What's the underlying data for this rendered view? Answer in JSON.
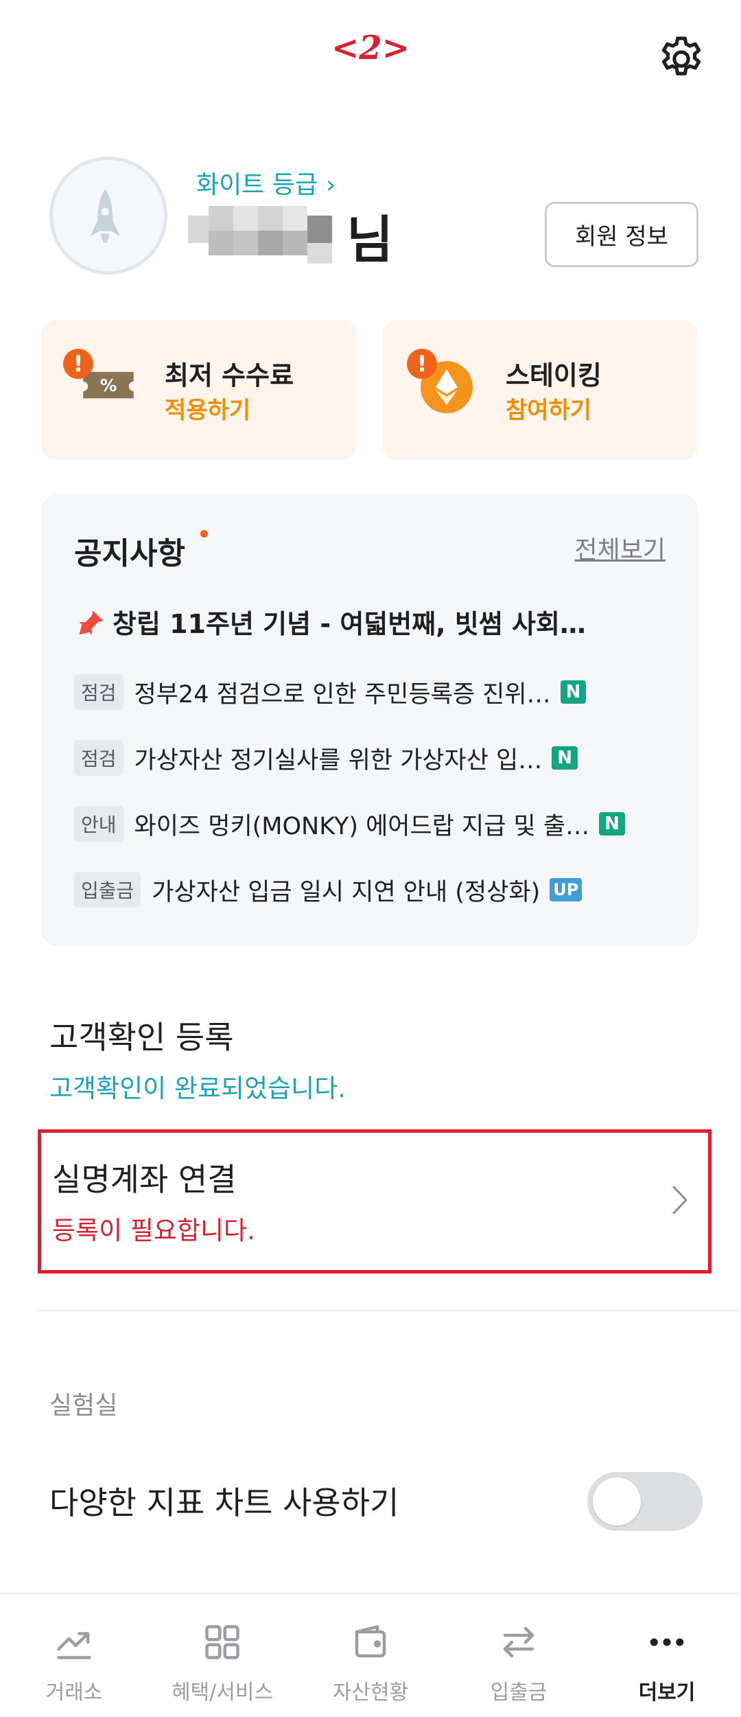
{
  "annotation": "<2>",
  "profile": {
    "grade": "화이트 등급",
    "suffix": "님",
    "member_button": "회원 정보"
  },
  "cards": [
    {
      "title": "최저 수수료",
      "action": "적용하기",
      "icon": "ticket-percent-icon"
    },
    {
      "title": "스테이킹",
      "action": "참여하기",
      "icon": "ethereum-coin-icon"
    }
  ],
  "notice": {
    "title": "공지사항",
    "view_all": "전체보기",
    "pinned": "창립 11주년 기념 - 여덟번째, 빗썸 사회…",
    "items": [
      {
        "tag": "점검",
        "text": "정부24 점검으로 인한 주민등록증 진위…",
        "badge": "N"
      },
      {
        "tag": "점검",
        "text": "가상자산 정기실사를 위한 가상자산 입…",
        "badge": "N"
      },
      {
        "tag": "안내",
        "text": "와이즈 멍키(MONKY) 에어드랍 지급 및 출…",
        "badge": "N"
      },
      {
        "tag": "입출금",
        "text": "가상자산 입금 일시 지연 안내 (정상화)",
        "badge": "UP"
      }
    ]
  },
  "kyc": {
    "title": "고객확인 등록",
    "status": "고객확인이 완료되었습니다."
  },
  "account": {
    "title": "실명계좌 연결",
    "status": "등록이 필요합니다."
  },
  "lab": {
    "section": "실험실",
    "toggle_label": "다양한 지표 차트 사용하기",
    "toggle_on": false
  },
  "tabs": [
    {
      "label": "거래소",
      "icon": "chart-line-icon"
    },
    {
      "label": "혜택/서비스",
      "icon": "grid-icon"
    },
    {
      "label": "자산현황",
      "icon": "wallet-icon"
    },
    {
      "label": "입출금",
      "icon": "transfer-arrows-icon"
    },
    {
      "label": "더보기",
      "icon": "more-dots-icon",
      "active": true
    }
  ],
  "colors": {
    "accent_teal": "#1aa3b0",
    "warning_orange": "#f28c00",
    "alert_red": "#dc1f2c",
    "new_badge": "#13a683",
    "up_badge": "#3f9ed6"
  }
}
